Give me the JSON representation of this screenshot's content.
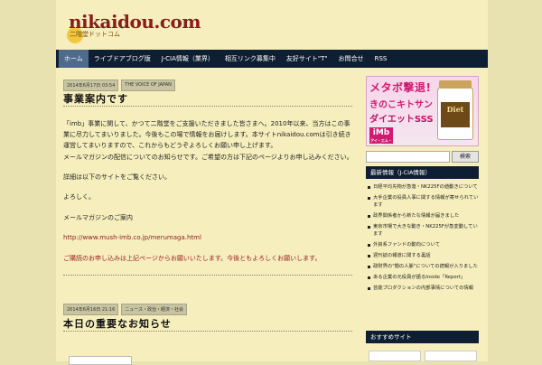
{
  "header": {
    "logo_text": "nikaidou.com",
    "logo_sub": "二階堂ドットコム"
  },
  "nav": {
    "items": [
      {
        "label": "ホーム"
      },
      {
        "label": "ライブドアブログ版"
      },
      {
        "label": "J-CIA情報（業界）"
      },
      {
        "label": "相互リンク募集中"
      },
      {
        "label": "友好サイト\"T\""
      },
      {
        "label": "お問合せ"
      },
      {
        "label": "RSS"
      }
    ]
  },
  "post1": {
    "date": "2014年6月17日 03:54",
    "category": "THE VOICE OF JAPAN",
    "title": "事業案内です",
    "p1": "「imb」事業に関して、かつて二階堂をご支援いただきました皆さまへ。2010年以来、当方はこの事業に尽力してまいりました。今後もこの場で情報をお届けします。本サイトnikaidou.comは引き続き運営してまいりますので、これからもどうぞよろしくお願い申し上げます。",
    "p2": "メールマガジンの配信についてのお知らせです。ご希望の方は下記のページよりお申し込みください。",
    "p3": "詳細は以下のサイトをご覧ください。",
    "p4": "よろしく。",
    "p5": "メールマガジンのご案内",
    "url": "http://www.mush-imb.co.jp/merumaga.html",
    "p6": "ご購読のお申し込みは上記ページからお願いいたします。今後ともよろしくお願いします。"
  },
  "post2": {
    "date": "2014年6月16日 21:16",
    "category": "ニュース・政治・経済・社会",
    "title": "本日の重要なお知らせ"
  },
  "sidebar": {
    "banner": {
      "line1": "メタボ撃退!",
      "line2": "きのこキトサン",
      "line3": "ダイエットSSS",
      "logo": "iMb",
      "logo_sub": "アイ・エム・ビー",
      "bottle_label": "Diet"
    },
    "search_button": "検索",
    "section1_title": "最新情報（J-CIA情報）",
    "links": [
      "日経平均先物が急落・NK225Fの値動きについて",
      "大手企業の役員人事に関する情報が寄せられています",
      "政界関係者から新たな情報が届きました",
      "東京市場で大きな動き・NK225Fが急変動しています",
      "外資系ファンドの動向について",
      "週刊誌の報道に関する裏話",
      "政財界の\"闇の人脈\"についての続報が入りました",
      "ある企業の元役員が語るInside「Report」",
      "芸能プロダクションの内部事情についての情報"
    ],
    "section2_title": "おすすめサイト"
  }
}
